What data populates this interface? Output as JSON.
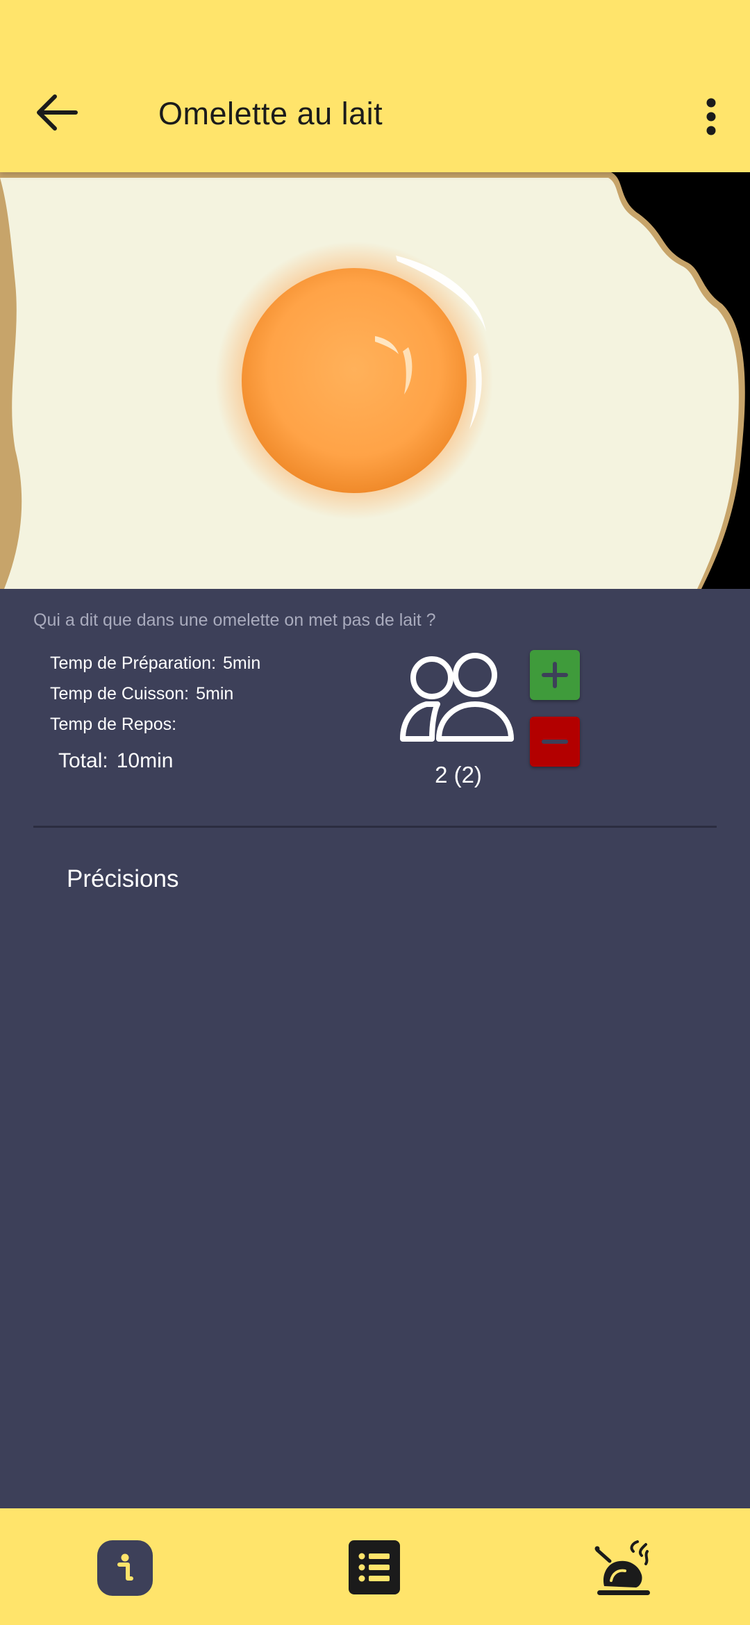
{
  "header": {
    "title": "Omelette au lait",
    "back_icon": "arrow-left-icon",
    "menu_icon": "more-vert-icon"
  },
  "hero": {
    "image": "fried-egg-photo"
  },
  "recipe": {
    "description": "Qui a dit que dans une omelette on met pas de lait ?",
    "prep_label": "Temp de Préparation:",
    "prep_value": "5min",
    "cook_label": "Temp de Cuisson:",
    "cook_value": "5min",
    "rest_label": "Temp de Repos:",
    "rest_value": "",
    "total_label": "Total:",
    "total_value": "10min"
  },
  "servings": {
    "icon": "people-icon",
    "value": "2 (2)",
    "plus_icon": "plus-icon",
    "minus_icon": "minus-icon"
  },
  "sections": {
    "precisions_title": "Précisions"
  },
  "bottom_nav": {
    "items": [
      {
        "icon": "info-icon"
      },
      {
        "icon": "list-icon"
      },
      {
        "icon": "cooking-icon"
      }
    ]
  },
  "colors": {
    "accent_yellow": "#ffe46b",
    "background": "#3d4059",
    "plus_green": "#3f9b3b",
    "minus_red": "#b30000",
    "text_dark": "#1b1b1b"
  }
}
